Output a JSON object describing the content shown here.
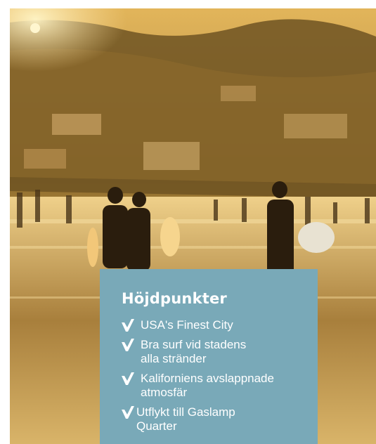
{
  "card": {
    "title": "Höjdpunkter",
    "items": [
      "USA's Finest City",
      "Bra surf vid stadens alla stränder",
      "Kaliforniens avslappnade atmosfär",
      "Utflykt till Gaslamp Quarter"
    ]
  },
  "colors": {
    "card_background": "#79a9b8",
    "text": "#ffffff",
    "photo_tone": "#d7a94f"
  },
  "icons": [
    "check-icon"
  ]
}
